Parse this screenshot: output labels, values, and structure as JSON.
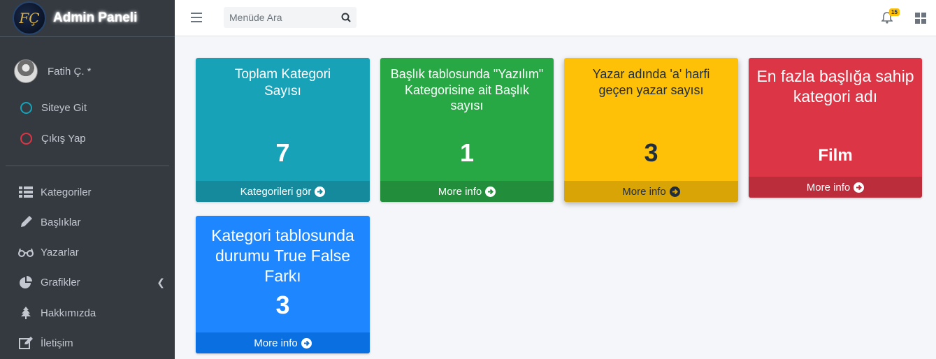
{
  "brand": {
    "title": "Admin Paneli",
    "logo_text": "FÇ"
  },
  "user": {
    "name": "Fatih Ç. *",
    "links": [
      "Siteye Git",
      "Çıkış Yap"
    ]
  },
  "nav": [
    {
      "label": "Kategoriler",
      "icon": "list-icon"
    },
    {
      "label": "Başlıklar",
      "icon": "pen-icon"
    },
    {
      "label": "Yazarlar",
      "icon": "glasses-icon"
    },
    {
      "label": "Grafikler",
      "icon": "pie-chart-icon"
    },
    {
      "label": "Hakkımızda",
      "icon": "tree-icon"
    },
    {
      "label": "İletişim",
      "icon": "edit-icon"
    }
  ],
  "topbar": {
    "search_placeholder": "Menüde Ara",
    "notification_count": "15"
  },
  "cards": [
    {
      "title": "Toplam Kategori Sayısı",
      "value": "7",
      "footer": "Kategorileri gör",
      "color": "#17a2b8"
    },
    {
      "title": "Başlık tablosunda \"Yazılım\" Kategorisine ait Başlık sayısı",
      "value": "1",
      "footer": "More info",
      "color": "#28a745"
    },
    {
      "title": "Yazar adında 'a' harfi geçen yazar sayısı",
      "value": "3",
      "footer": "More info",
      "color": "#ffc107"
    },
    {
      "title": "En fazla başlığa sahip kategori adı",
      "value": "Film",
      "footer": "More info",
      "color": "#dc3545"
    },
    {
      "title": "Kategori tablosunda durumu True False Farkı",
      "value": "3",
      "footer": "More info",
      "color": "#1e87ff"
    }
  ]
}
